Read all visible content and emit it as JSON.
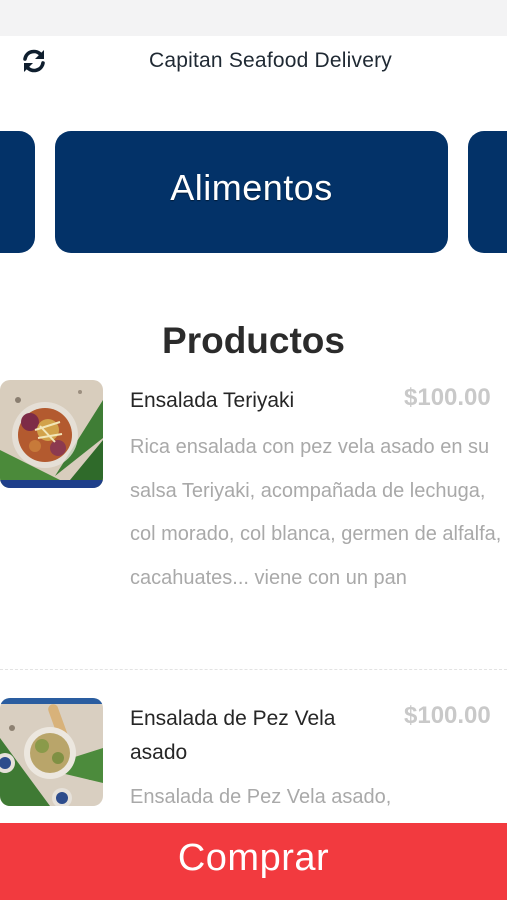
{
  "header": {
    "title": "Capitan Seafood Delivery",
    "refresh_icon": "refresh-icon"
  },
  "categories": {
    "active_label": "Alimentos",
    "color": "#033268"
  },
  "section": {
    "title": "Productos"
  },
  "products": [
    {
      "name": "Ensalada Teriyaki",
      "price": "$100.00",
      "description": "Rica ensalada con pez vela asado en su salsa Teriyaki, acompañada de lechuga, col morado, col blanca, germen de alfalfa, cacahuates... viene con un pan"
    },
    {
      "name": "Ensalada de Pez Vela asado",
      "price": "$100.00",
      "description": "Ensalada de Pez Vela asado,"
    }
  ],
  "footer": {
    "buy_label": "Comprar",
    "color": "#f23a3f"
  }
}
